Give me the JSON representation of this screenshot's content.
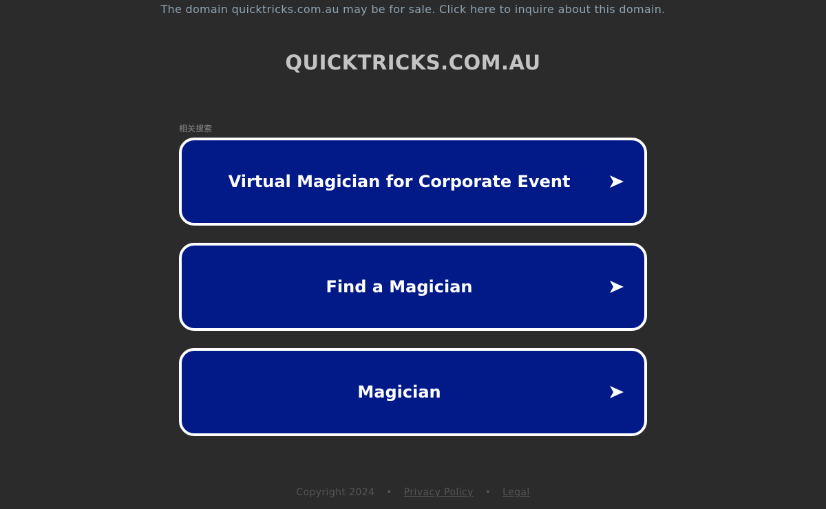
{
  "banner": {
    "text": "The domain quicktricks.com.au may be for sale. Click here to inquire about this domain."
  },
  "domain": {
    "title": "QUICKTRICKS.COM.AU"
  },
  "related": {
    "label": "相关搜索",
    "items": [
      {
        "label": "Virtual Magician for Corporate Event",
        "icon": "arrow-right-icon"
      },
      {
        "label": "Find a Magician",
        "icon": "arrow-right-icon"
      },
      {
        "label": "Magician",
        "icon": "arrow-right-icon"
      }
    ]
  },
  "footer": {
    "copyright": "Copyright 2024",
    "separator": "•",
    "privacy": "Privacy Policy",
    "legal": "Legal"
  },
  "colors": {
    "background": "#2b2b2b",
    "button_fill": "#011a88",
    "button_border": "#ffffff",
    "banner_text": "#8fa4b3",
    "title_text": "#c4c4c4"
  }
}
